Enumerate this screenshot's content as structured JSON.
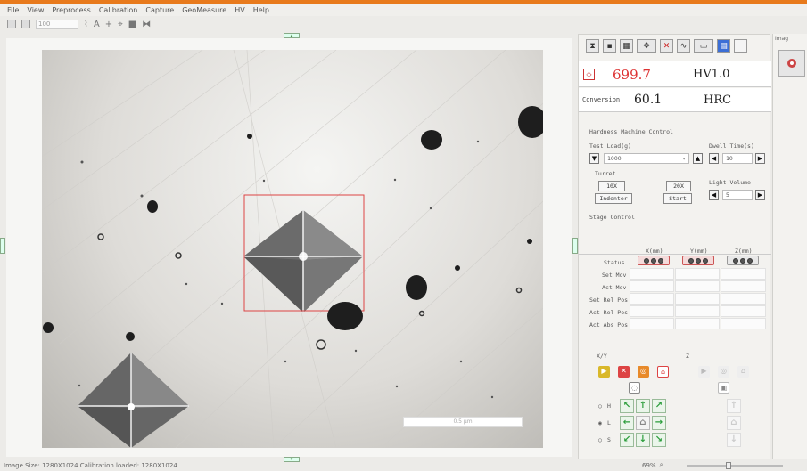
{
  "menu": [
    "File",
    "View",
    "Preprocess",
    "Calibration",
    "Capture",
    "GeoMeasure",
    "HV",
    "Help"
  ],
  "toolbar": {
    "zoom_select": "100"
  },
  "image": {
    "scale_label": "0.5 μm"
  },
  "status": {
    "text": "Image Size: 1280X1024  Calibration loaded: 1280X1024",
    "zoom": "69%"
  },
  "hv": {
    "value": "699.7",
    "scale": "HV1.0"
  },
  "conversion": {
    "label": "Conversion",
    "value": "60.1",
    "scale": "HRC"
  },
  "hardness_control": {
    "title": "Hardness Machine Control",
    "test_load_label": "Test Load(g)",
    "test_load_value": "1000",
    "dwell_label": "Dwell Time(s)",
    "dwell_value": "10",
    "turret_label": "Turret",
    "turret_10x": "10X",
    "turret_20x": "20X",
    "indenter": "Indenter",
    "start": "Start",
    "light_label": "Light Volume",
    "light_value": "5"
  },
  "stage": {
    "title": "Stage Control",
    "columns": [
      "X(mm)",
      "Y(mm)",
      "Z(mm)"
    ],
    "rows": [
      "Status",
      "Set Mov",
      "Act Mov",
      "Set Rel Pos",
      "Act Rel Pos",
      "Act Abs Pos"
    ]
  },
  "motion": {
    "xy_label": "X/Y",
    "z_label": "Z",
    "speed_labels": [
      "H",
      "L",
      "S"
    ]
  },
  "strip": {
    "title": "Imag"
  },
  "colors": {
    "accent_red": "#d33333",
    "move_green": "#2a9d3a",
    "frame_orange": "#e87a1c"
  }
}
